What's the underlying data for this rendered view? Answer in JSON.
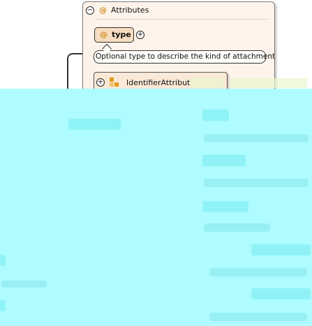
{
  "attributes_box": {
    "title": "Attributes",
    "collapse_symbol": "⊖",
    "attribute_marker": "@"
  },
  "type_attribute": {
    "label": "type",
    "marker": "@",
    "expand_symbol": "+"
  },
  "tooltip": {
    "text": "Optional type to describe the kind of attachment"
  },
  "identifier_group": {
    "label": "IdentifierAttribut",
    "expand_symbol": "+"
  },
  "icons": {
    "collapse": "collapse-circle-icon",
    "expand": "expand-circle-icon",
    "attribute": "at-sign-icon",
    "group": "attribute-group-icon"
  },
  "colors": {
    "box_background": "#fdf3ea",
    "pill_background": "#f6dcc0",
    "attribute_marker": "#d48a1a",
    "overlay": "#aefcff"
  }
}
